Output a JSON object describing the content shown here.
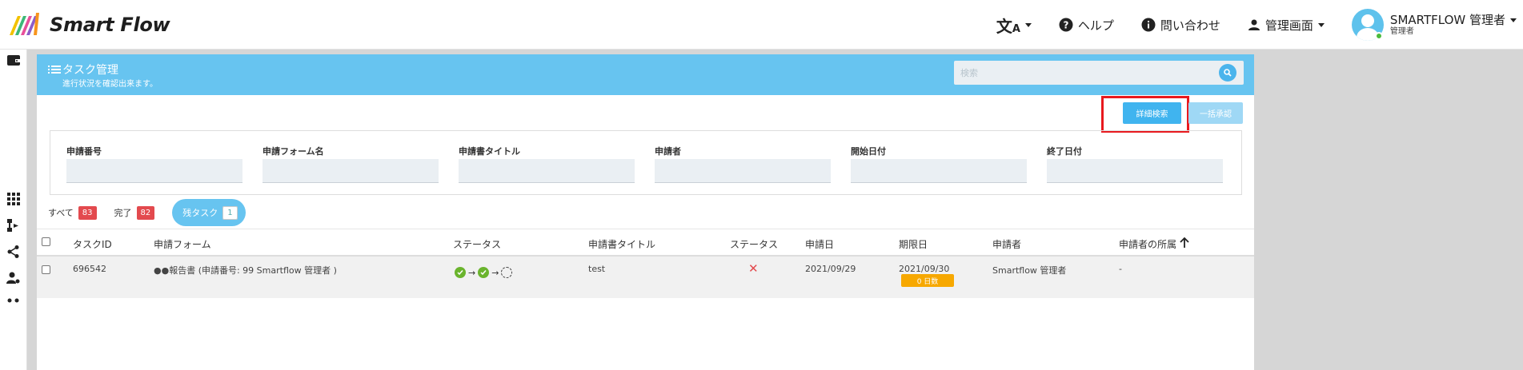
{
  "header": {
    "brand": "Smart Flow",
    "lang_icon": "translate-icon",
    "help_label": "ヘルプ",
    "contact_label": "問い合わせ",
    "admin_label": "管理画面",
    "user_name": "SMARTFLOW 管理者",
    "user_role": "管理者"
  },
  "sidebar": {
    "icons": [
      "wallet-icon",
      "apps-grid-icon",
      "flow-icon",
      "share-icon",
      "user-settings-icon",
      "more-icon"
    ]
  },
  "card": {
    "title": "タスク管理",
    "subtitle": "進行状況を確認出来ます。",
    "search_placeholder": "検索"
  },
  "buttons": {
    "detail_search": "詳細検索",
    "bulk_approve": "一括承認"
  },
  "filters": [
    {
      "label": "申請番号"
    },
    {
      "label": "申請フォーム名"
    },
    {
      "label": "申請書タイトル"
    },
    {
      "label": "申請者"
    },
    {
      "label": "開始日付"
    },
    {
      "label": "終了日付"
    }
  ],
  "tabs": [
    {
      "label": "すべて",
      "count": "83"
    },
    {
      "label": "完了",
      "count": "82"
    },
    {
      "label": "残タスク",
      "count": "1"
    }
  ],
  "table": {
    "headers": [
      "タスクID",
      "申請フォーム",
      "ステータス",
      "申請書タイトル",
      "ステータス",
      "申請日",
      "期限日",
      "申請者",
      "申請者の所属"
    ],
    "sort_icon": "arrow-up-icon",
    "rows": [
      {
        "task_id": "696542",
        "form": "●●報告書 (申請番号: 99 Smartflow 管理者 )",
        "flow": [
          "done",
          "done",
          "pending"
        ],
        "title": "test",
        "status": "✕",
        "applied": "2021/09/29",
        "deadline": "2021/09/30",
        "deadline_badge": "0 日数",
        "applicant": "Smartflow 管理者",
        "affiliation": "-"
      }
    ]
  },
  "colors": {
    "accent": "#67c4f0",
    "button": "#40b4ef",
    "badge_red": "#e34a4e",
    "deadline": "#f7a800",
    "done": "#6ab42d",
    "highlight": "#e8191e"
  }
}
